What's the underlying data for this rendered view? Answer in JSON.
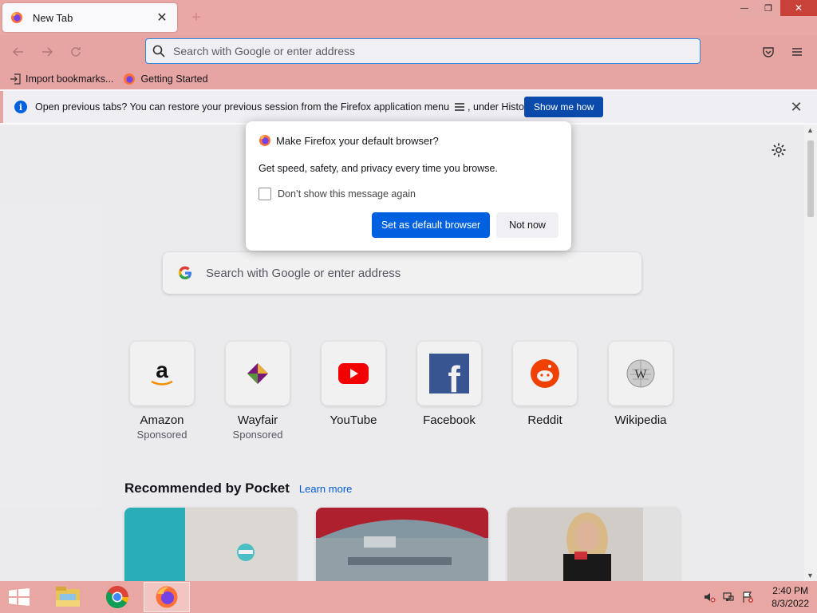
{
  "tab": {
    "title": "New Tab",
    "close_glyph": "✕"
  },
  "window": {
    "new_tab_glyph": "+",
    "minimize_glyph": "—",
    "restore_glyph": "❐",
    "close_glyph": "✕"
  },
  "toolbar": {
    "url_placeholder": "Search with Google or enter address",
    "back_icon": "arrow-left-icon",
    "forward_icon": "arrow-right-icon",
    "reload_icon": "reload-icon"
  },
  "bookmarks": [
    {
      "label": "Import bookmarks...",
      "icon": "import-icon"
    },
    {
      "label": "Getting Started",
      "icon": "firefox-icon"
    }
  ],
  "infobar": {
    "message": "Open previous tabs? You can restore your previous session from the Firefox application menu",
    "message_suffix": ", under History.",
    "button": "Show me how",
    "close_glyph": "✕"
  },
  "modal": {
    "title": "Make Firefox your default browser?",
    "body": "Get speed, safety, and privacy every time you browse.",
    "checkbox_label": "Don’t show this message again",
    "checkbox_checked": false,
    "primary_button": "Set as default browser",
    "secondary_button": "Not now"
  },
  "page_search": {
    "placeholder": "Search with Google or enter address"
  },
  "top_sites": [
    {
      "label": "Amazon",
      "sponsored": "Sponsored",
      "icon": "amazon-icon"
    },
    {
      "label": "Wayfair",
      "sponsored": "Sponsored",
      "icon": "wayfair-icon"
    },
    {
      "label": "YouTube",
      "sponsored": "",
      "icon": "youtube-icon"
    },
    {
      "label": "Facebook",
      "sponsored": "",
      "icon": "facebook-icon"
    },
    {
      "label": "Reddit",
      "sponsored": "",
      "icon": "reddit-icon"
    },
    {
      "label": "Wikipedia",
      "sponsored": "",
      "icon": "wikipedia-icon"
    }
  ],
  "pocket": {
    "title": "Recommended by Pocket",
    "link": "Learn more"
  },
  "taskbar": {
    "items": [
      "file-explorer-icon",
      "chrome-icon",
      "firefox-icon"
    ],
    "active_item": "firefox-icon",
    "time": "2:40 PM",
    "date": "8/3/2022"
  },
  "colors": {
    "accent": "#0061e0",
    "titlebar": "#e9a8a4",
    "infobar_button": "#0a4aab"
  }
}
